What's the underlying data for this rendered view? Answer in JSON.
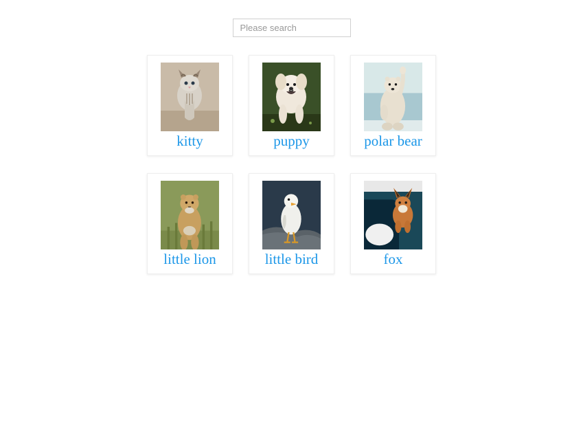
{
  "search": {
    "placeholder": "Please search"
  },
  "cards": [
    {
      "title": "kitty"
    },
    {
      "title": "puppy"
    },
    {
      "title": "polar bear"
    },
    {
      "title": "little lion"
    },
    {
      "title": "little bird"
    },
    {
      "title": "fox"
    }
  ]
}
